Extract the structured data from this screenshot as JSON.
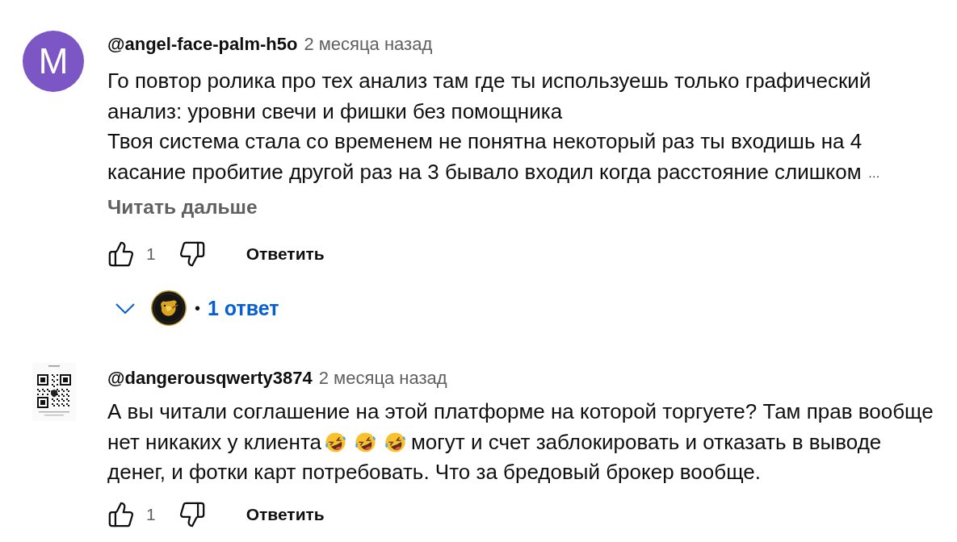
{
  "comments": [
    {
      "avatar": {
        "kind": "letter",
        "letter": "M"
      },
      "author": "@angel-face-palm-h5o",
      "time": "2 месяца назад",
      "lines": [
        [
          {
            "kind": "text",
            "text": "Го повтор ролика про тех анализ там где ты используешь только графический"
          }
        ],
        [
          {
            "kind": "text",
            "text": "анализ: уровни свечи и фишки без помощника"
          }
        ],
        [
          {
            "kind": "text",
            "text": "Твоя система стала со временем не понятна некоторый раз ты входишь на 4"
          }
        ],
        [
          {
            "kind": "text",
            "text": "касание пробитие другой раз на 3 бывало входил когда расстояние слишком"
          },
          {
            "kind": "ellipsis",
            "text": "…"
          }
        ]
      ],
      "read_more": "Читать дальше",
      "likes": "1",
      "reply_button": "Ответить",
      "replies": {
        "separator": "•",
        "label": "1 ответ"
      }
    },
    {
      "avatar": {
        "kind": "qr"
      },
      "author": "@dangerousqwerty3874",
      "time": "2 месяца назад",
      "lines": [
        [
          {
            "kind": "text",
            "text": "А вы читали соглашение на этой платформе на которой торгуете? Там прав вообще"
          }
        ],
        [
          {
            "kind": "text",
            "text": "нет никаких у клиента"
          },
          {
            "kind": "emoji"
          },
          {
            "kind": "emoji"
          },
          {
            "kind": "emoji"
          },
          {
            "kind": "text",
            "text": "могут и счет заблокировать и отказать в выводе"
          }
        ],
        [
          {
            "kind": "text",
            "text": "денег, и фотки карт потребовать. Что за бредовый брокер вообще."
          }
        ]
      ],
      "likes": "1",
      "reply_button": "Ответить"
    }
  ]
}
